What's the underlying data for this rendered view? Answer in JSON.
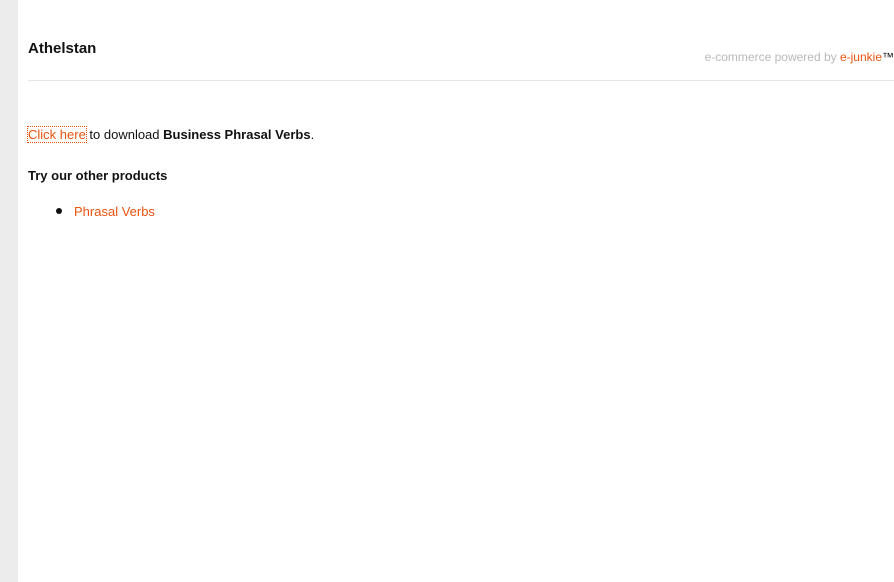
{
  "header": {
    "store_name": "Athelstan",
    "powered_by_text": "e-commerce powered by ",
    "powered_by_link": "e-junkie",
    "trademark": "™"
  },
  "download": {
    "link_label": "Click here",
    "middle_text": " to download ",
    "product_name": "Business Phrasal Verbs",
    "end_text": "."
  },
  "other_products": {
    "heading": "Try our other products",
    "items": [
      {
        "label": "Phrasal Verbs"
      }
    ]
  },
  "colors": {
    "link": "#e8530f",
    "muted_text": "#b9b9b9",
    "side_strip": "#ececec"
  }
}
